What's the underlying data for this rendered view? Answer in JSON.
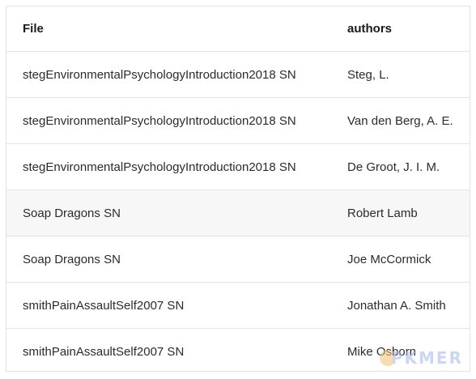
{
  "table": {
    "headers": {
      "file": "File",
      "authors": "authors"
    },
    "rows": [
      {
        "file": "stegEnvironmentalPsychologyIntroduction2018 SN",
        "authors": "Steg, L."
      },
      {
        "file": "stegEnvironmentalPsychologyIntroduction2018 SN",
        "authors": "Van den Berg, A. E."
      },
      {
        "file": "stegEnvironmentalPsychologyIntroduction2018 SN",
        "authors": "De Groot, J. I. M."
      },
      {
        "file": "Soap Dragons SN",
        "authors": "Robert Lamb"
      },
      {
        "file": "Soap Dragons SN",
        "authors": "Joe McCormick"
      },
      {
        "file": "smithPainAssaultSelf2007 SN",
        "authors": "Jonathan A. Smith"
      },
      {
        "file": "smithPainAssaultSelf2007 SN",
        "authors": "Mike Osborn"
      }
    ]
  },
  "watermark": {
    "text": "PKMER",
    "icon": "pkmer-logo-icon",
    "color": "#9db8e8"
  }
}
